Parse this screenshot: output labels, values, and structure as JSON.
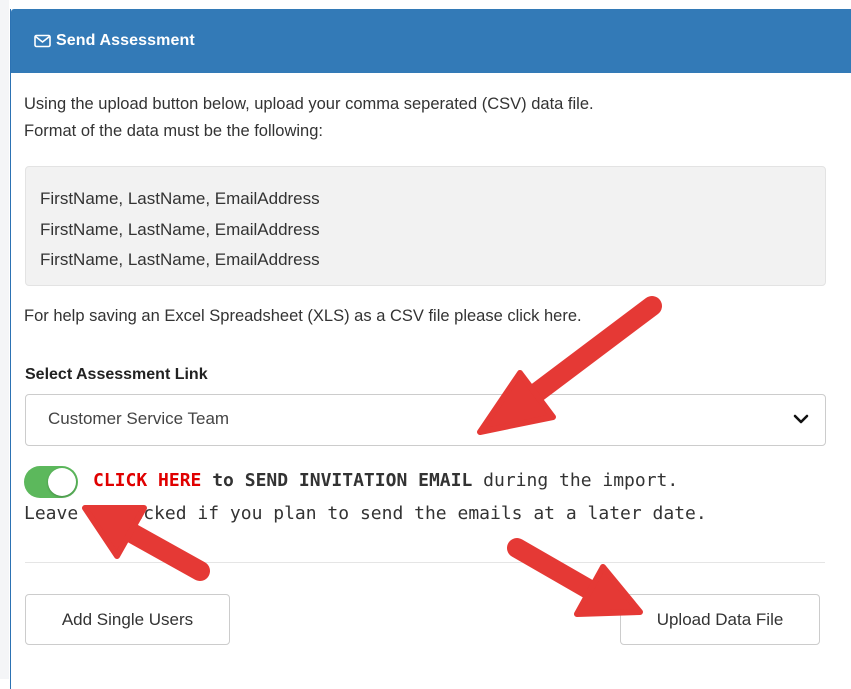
{
  "panel": {
    "title": "Send Assessment",
    "icon": "envelope-icon",
    "header_color": "#337ab7"
  },
  "intro": {
    "line1": "Using the upload button below, upload your comma seperated (CSV) data file.",
    "line2": "Format of the data must be the following:"
  },
  "format_example": {
    "lines": [
      "FirstName, LastName, EmailAddress",
      "FirstName, LastName, EmailAddress",
      "FirstName, LastName, EmailAddress"
    ]
  },
  "help_text": "For help saving an Excel Spreadsheet (XLS) as a CSV file please click here.",
  "assessment_select": {
    "label": "Select Assessment Link",
    "value": "Customer Service Team",
    "icon": "chevron-down-icon"
  },
  "invite_toggle": {
    "checked": true,
    "color": "#5cb85c",
    "click_here": "CLICK HERE",
    "to_send": "to SEND INVITATION EMAIL",
    "suffix": "during the import.",
    "note": "Leave unchecked if you plan to send the emails at a later date."
  },
  "buttons": {
    "add_single_users": "Add Single Users",
    "upload_data_file": "Upload Data File"
  },
  "annotation_color": "#e53935"
}
